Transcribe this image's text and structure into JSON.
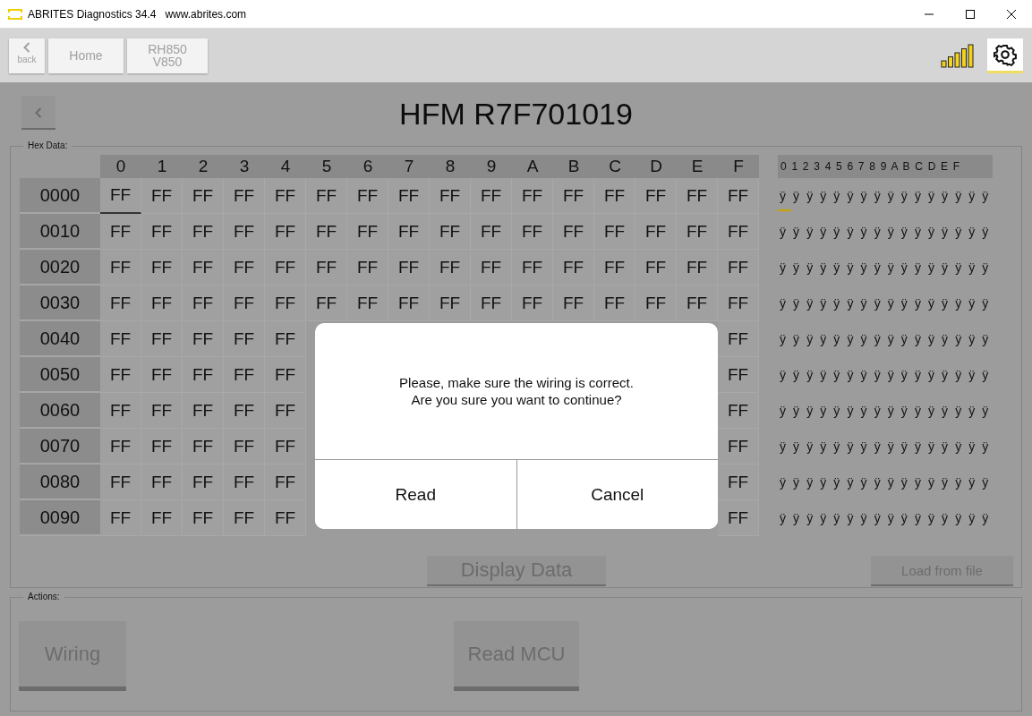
{
  "window": {
    "title": "ABRITES Diagnostics 34.4",
    "url": "www.abrites.com"
  },
  "toolbar": {
    "back_label": "back",
    "breadcrumbs": [
      "Home",
      "RH850\nV850"
    ]
  },
  "page": {
    "title": "HFM R7F701019"
  },
  "hex_data": {
    "legend": "Hex Data:",
    "columns": [
      "0",
      "1",
      "2",
      "3",
      "4",
      "5",
      "6",
      "7",
      "8",
      "9",
      "A",
      "B",
      "C",
      "D",
      "E",
      "F"
    ],
    "ascii_header": "0 1 2 3 4 5 6 7 8 9 A B C D E F",
    "rows": [
      {
        "address": "0000",
        "ascii": "ÿ ÿ ÿ ÿ ÿ ÿ ÿ ÿ ÿ ÿ ÿ ÿ ÿ ÿ ÿ ÿ",
        "cells": [
          {
            "value": "FF",
            "selected": true
          },
          {
            "value": "FF",
            "selected": false
          },
          {
            "value": "FF",
            "selected": false
          },
          {
            "value": "FF",
            "selected": false
          },
          {
            "value": "FF",
            "selected": false
          },
          {
            "value": "FF",
            "selected": false
          },
          {
            "value": "FF",
            "selected": false
          },
          {
            "value": "FF",
            "selected": false
          },
          {
            "value": "FF",
            "selected": false
          },
          {
            "value": "FF",
            "selected": false
          },
          {
            "value": "FF",
            "selected": false
          },
          {
            "value": "FF",
            "selected": false
          },
          {
            "value": "FF",
            "selected": false
          },
          {
            "value": "FF",
            "selected": false
          },
          {
            "value": "FF",
            "selected": false
          },
          {
            "value": "FF",
            "selected": false
          }
        ]
      },
      {
        "address": "0010",
        "ascii": "ÿ ÿ ÿ ÿ ÿ ÿ ÿ ÿ ÿ ÿ ÿ ÿ ÿ ÿ ÿ ÿ",
        "cells": [
          {
            "value": "FF",
            "selected": false
          },
          {
            "value": "FF",
            "selected": false
          },
          {
            "value": "FF",
            "selected": false
          },
          {
            "value": "FF",
            "selected": false
          },
          {
            "value": "FF",
            "selected": false
          },
          {
            "value": "FF",
            "selected": false
          },
          {
            "value": "FF",
            "selected": false
          },
          {
            "value": "FF",
            "selected": false
          },
          {
            "value": "FF",
            "selected": false
          },
          {
            "value": "FF",
            "selected": false
          },
          {
            "value": "FF",
            "selected": false
          },
          {
            "value": "FF",
            "selected": false
          },
          {
            "value": "FF",
            "selected": false
          },
          {
            "value": "FF",
            "selected": false
          },
          {
            "value": "FF",
            "selected": false
          },
          {
            "value": "FF",
            "selected": false
          }
        ]
      },
      {
        "address": "0020",
        "ascii": "ÿ ÿ ÿ ÿ ÿ ÿ ÿ ÿ ÿ ÿ ÿ ÿ ÿ ÿ ÿ ÿ",
        "cells": [
          {
            "value": "FF",
            "selected": false
          },
          {
            "value": "FF",
            "selected": false
          },
          {
            "value": "FF",
            "selected": false
          },
          {
            "value": "FF",
            "selected": false
          },
          {
            "value": "FF",
            "selected": false
          },
          {
            "value": "FF",
            "selected": false
          },
          {
            "value": "FF",
            "selected": false
          },
          {
            "value": "FF",
            "selected": false
          },
          {
            "value": "FF",
            "selected": false
          },
          {
            "value": "FF",
            "selected": false
          },
          {
            "value": "FF",
            "selected": false
          },
          {
            "value": "FF",
            "selected": false
          },
          {
            "value": "FF",
            "selected": false
          },
          {
            "value": "FF",
            "selected": false
          },
          {
            "value": "FF",
            "selected": false
          },
          {
            "value": "FF",
            "selected": false
          }
        ]
      },
      {
        "address": "0030",
        "ascii": "ÿ ÿ ÿ ÿ ÿ ÿ ÿ ÿ ÿ ÿ ÿ ÿ ÿ ÿ ÿ ÿ",
        "cells": [
          {
            "value": "FF",
            "selected": false
          },
          {
            "value": "FF",
            "selected": false
          },
          {
            "value": "FF",
            "selected": false
          },
          {
            "value": "FF",
            "selected": false
          },
          {
            "value": "FF",
            "selected": false
          },
          {
            "value": "FF",
            "selected": false
          },
          {
            "value": "FF",
            "selected": false
          },
          {
            "value": "FF",
            "selected": false
          },
          {
            "value": "FF",
            "selected": false
          },
          {
            "value": "FF",
            "selected": false
          },
          {
            "value": "FF",
            "selected": false
          },
          {
            "value": "FF",
            "selected": false
          },
          {
            "value": "FF",
            "selected": false
          },
          {
            "value": "FF",
            "selected": false
          },
          {
            "value": "FF",
            "selected": false
          },
          {
            "value": "FF",
            "selected": false
          }
        ]
      },
      {
        "address": "0040",
        "ascii": "ÿ ÿ ÿ ÿ ÿ ÿ ÿ ÿ ÿ ÿ ÿ ÿ ÿ ÿ ÿ ÿ",
        "cells": [
          {
            "value": "FF",
            "selected": false
          },
          {
            "value": "FF",
            "selected": false
          },
          {
            "value": "FF",
            "selected": false
          },
          {
            "value": "FF",
            "selected": false
          },
          {
            "value": "FF",
            "selected": false
          },
          null,
          null,
          null,
          null,
          null,
          null,
          null,
          null,
          null,
          null,
          {
            "value": "FF",
            "selected": false
          }
        ]
      },
      {
        "address": "0050",
        "ascii": "ÿ ÿ ÿ ÿ ÿ ÿ ÿ ÿ ÿ ÿ ÿ ÿ ÿ ÿ ÿ ÿ",
        "cells": [
          {
            "value": "FF",
            "selected": false
          },
          {
            "value": "FF",
            "selected": false
          },
          {
            "value": "FF",
            "selected": false
          },
          {
            "value": "FF",
            "selected": false
          },
          {
            "value": "FF",
            "selected": false
          },
          null,
          null,
          null,
          null,
          null,
          null,
          null,
          null,
          null,
          null,
          {
            "value": "FF",
            "selected": false
          }
        ]
      },
      {
        "address": "0060",
        "ascii": "ÿ ÿ ÿ ÿ ÿ ÿ ÿ ÿ ÿ ÿ ÿ ÿ ÿ ÿ ÿ ÿ",
        "cells": [
          {
            "value": "FF",
            "selected": false
          },
          {
            "value": "FF",
            "selected": false
          },
          {
            "value": "FF",
            "selected": false
          },
          {
            "value": "FF",
            "selected": false
          },
          {
            "value": "FF",
            "selected": false
          },
          null,
          null,
          null,
          null,
          null,
          null,
          null,
          null,
          null,
          null,
          {
            "value": "FF",
            "selected": false
          }
        ]
      },
      {
        "address": "0070",
        "ascii": "ÿ ÿ ÿ ÿ ÿ ÿ ÿ ÿ ÿ ÿ ÿ ÿ ÿ ÿ ÿ ÿ",
        "cells": [
          {
            "value": "FF",
            "selected": false
          },
          {
            "value": "FF",
            "selected": false
          },
          {
            "value": "FF",
            "selected": false
          },
          {
            "value": "FF",
            "selected": false
          },
          {
            "value": "FF",
            "selected": false
          },
          null,
          null,
          null,
          null,
          null,
          null,
          null,
          null,
          null,
          null,
          {
            "value": "FF",
            "selected": false
          }
        ]
      },
      {
        "address": "0080",
        "ascii": "ÿ ÿ ÿ ÿ ÿ ÿ ÿ ÿ ÿ ÿ ÿ ÿ ÿ ÿ ÿ ÿ",
        "cells": [
          {
            "value": "FF",
            "selected": false
          },
          {
            "value": "FF",
            "selected": false
          },
          {
            "value": "FF",
            "selected": false
          },
          {
            "value": "FF",
            "selected": false
          },
          {
            "value": "FF",
            "selected": false
          },
          null,
          null,
          null,
          null,
          null,
          null,
          null,
          null,
          null,
          null,
          {
            "value": "FF",
            "selected": false
          }
        ]
      },
      {
        "address": "0090",
        "ascii": "ÿ ÿ ÿ ÿ ÿ ÿ ÿ ÿ ÿ ÿ ÿ ÿ ÿ ÿ ÿ ÿ",
        "cells": [
          {
            "value": "FF",
            "selected": false
          },
          {
            "value": "FF",
            "selected": false
          },
          {
            "value": "FF",
            "selected": false
          },
          {
            "value": "FF",
            "selected": false
          },
          {
            "value": "FF",
            "selected": false
          },
          null,
          null,
          null,
          null,
          null,
          null,
          null,
          null,
          null,
          null,
          {
            "value": "FF",
            "selected": false
          }
        ]
      }
    ],
    "buttons": [
      "Display Data",
      "Load from file"
    ]
  },
  "actions": {
    "legend": "Actions:",
    "buttons": [
      "Wiring",
      "Read MCU"
    ]
  },
  "dialog": {
    "message": "Please, make sure the wiring is correct.\nAre you sure you want to continue?",
    "buttons": [
      "Read",
      "Cancel"
    ]
  }
}
